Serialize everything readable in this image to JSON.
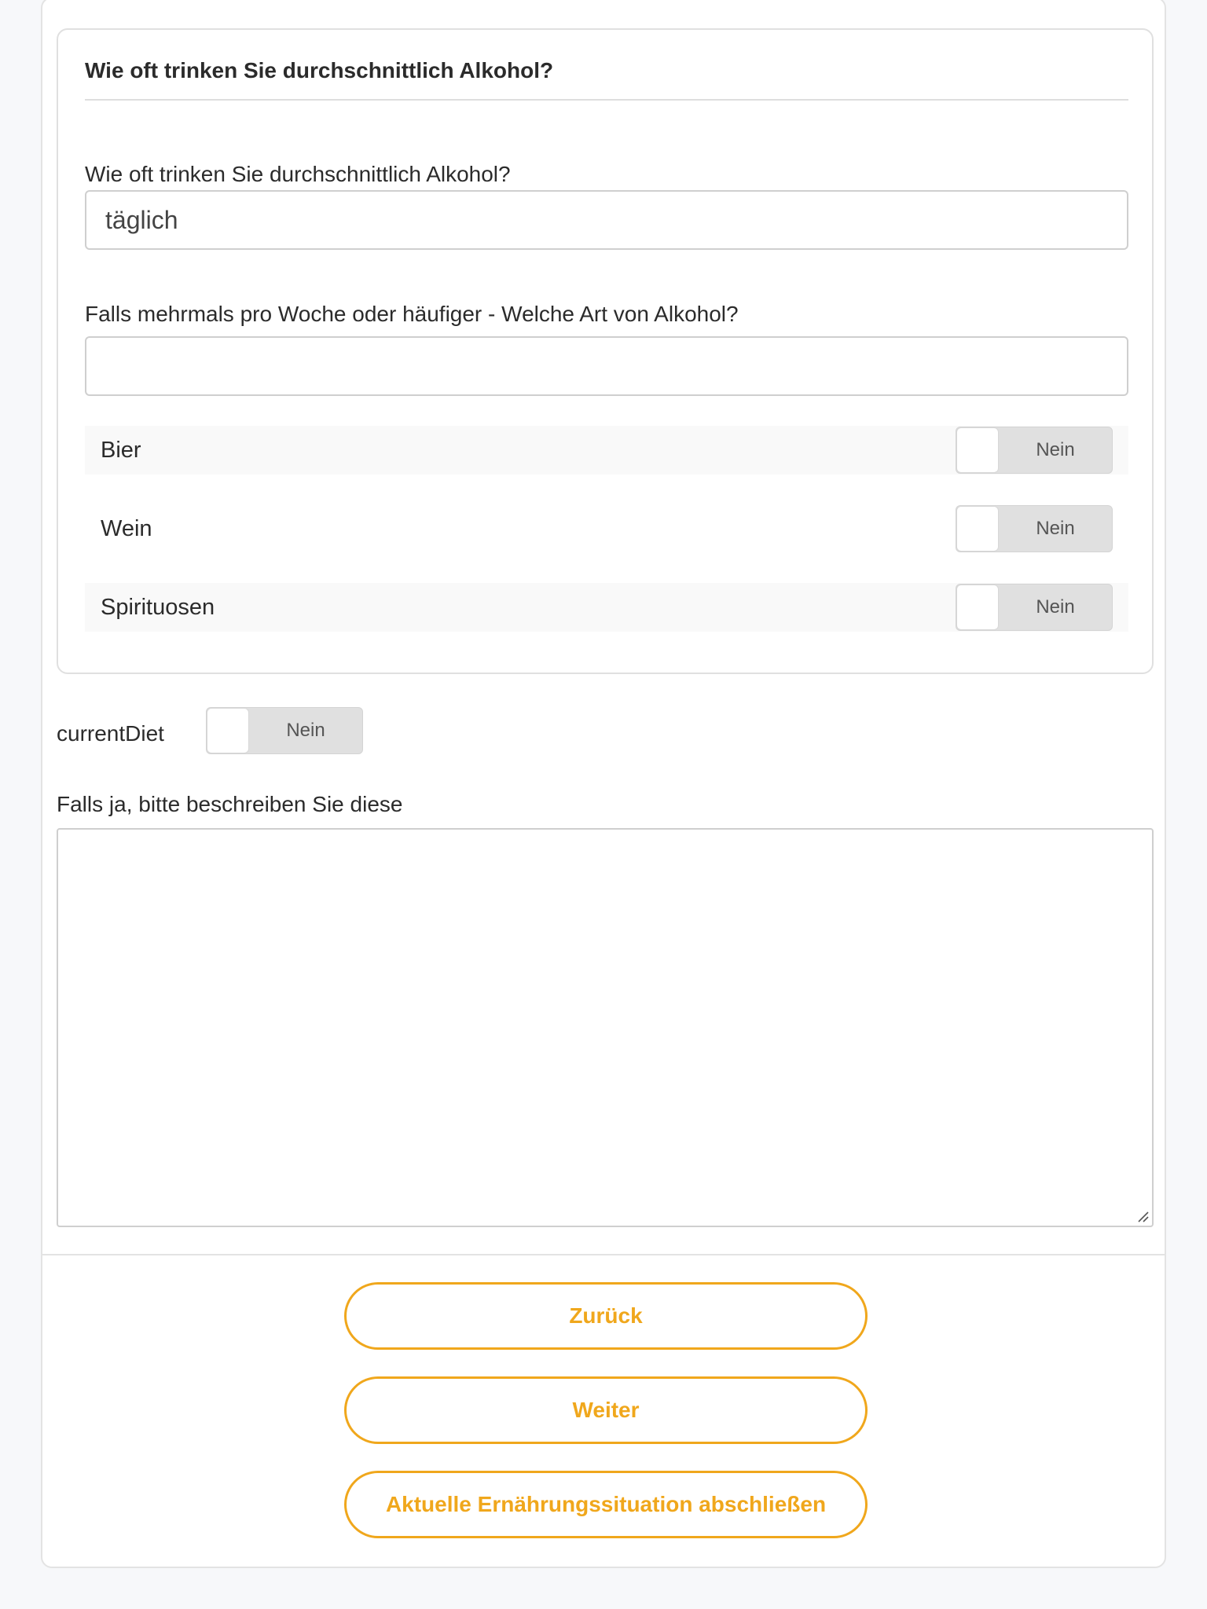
{
  "alcohol_card": {
    "title": "Wie oft trinken Sie durchschnittlich Alkohol?",
    "frequency_label": "Wie oft trinken Sie durchschnittlich Alkohol?",
    "frequency_value": "täglich",
    "type_label": "Falls mehrmals pro Woche oder häufiger - Welche Art von Alkohol?",
    "type_value": "",
    "options": [
      {
        "label": "Bier",
        "toggle_text": "Nein",
        "checked": false
      },
      {
        "label": "Wein",
        "toggle_text": "Nein",
        "checked": false
      },
      {
        "label": "Spirituosen",
        "toggle_text": "Nein",
        "checked": false
      }
    ]
  },
  "diet": {
    "label": "currentDiet",
    "toggle_text": "Nein",
    "checked": false,
    "describe_label": "Falls ja, bitte beschreiben Sie diese",
    "describe_value": ""
  },
  "buttons": {
    "back": "Zurück",
    "next": "Weiter",
    "finish": "Aktuelle Ernährungssituation abschließen"
  },
  "colors": {
    "accent": "#f0a71c",
    "toggle_off": "#e0e0e0",
    "border": "#cfcfcf"
  }
}
